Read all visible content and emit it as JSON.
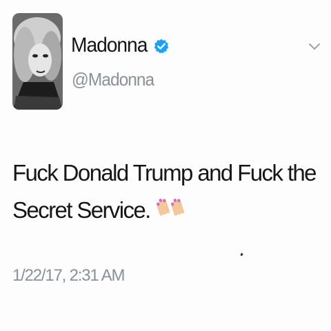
{
  "user": {
    "display_name": "Madonna",
    "handle": "@Madonna",
    "verified": true
  },
  "tweet": {
    "text": "Fuck Donald Trump and Fuck the Secret Service.",
    "emoji": "painted-nails-emoji",
    "timestamp": "1/22/17, 2:31 AM"
  },
  "icons": {
    "verified": "verified-badge-icon",
    "menu": "chevron-down-icon"
  },
  "colors": {
    "verified_blue": "#1da1f2",
    "secondary_text": "#8a9097",
    "nail_pink": "#d36fc1",
    "skin": "#f2c79a"
  }
}
